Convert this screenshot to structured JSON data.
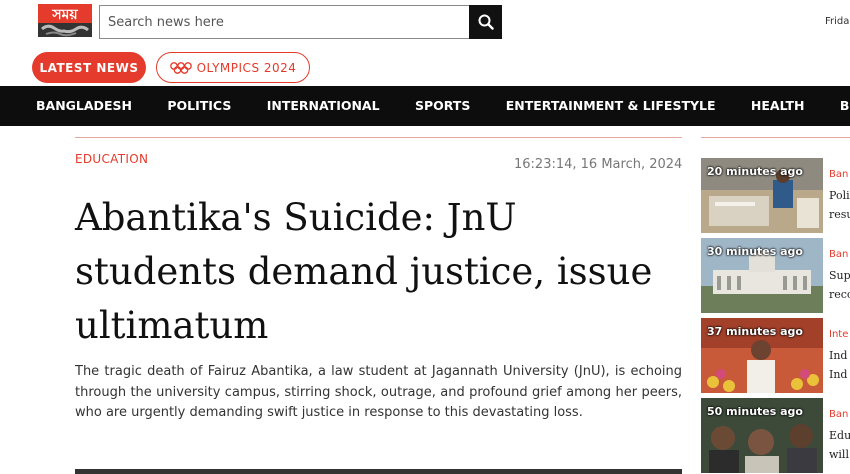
{
  "header": {
    "logo_text": "সময়",
    "search_placeholder": "Search news here",
    "date_partial": "Frida"
  },
  "pills": {
    "latest": "LATEST NEWS",
    "olympics": "OLYMPICS 2024"
  },
  "nav": [
    "BANGLADESH",
    "POLITICS",
    "INTERNATIONAL",
    "SPORTS",
    "ENTERTAINMENT & LIFESTYLE",
    "HEALTH",
    "BUSINESS"
  ],
  "article": {
    "category": "EDUCATION",
    "timestamp": "16:23:14, 16 March, 2024",
    "headline": "Abantika's Suicide: JnU students demand justice, issue ultimatum",
    "summary": "The tragic death of Fairuz Abantika, a law student at Jagannath University (JnU), is echoing through the university campus, stirring shock, outrage, and profound grief among her peers, who are urgently demanding swift justice in response to this devastating loss."
  },
  "sidebar": [
    {
      "time": "20 minutes ago",
      "category": "Ban",
      "title": "Poli\nresu"
    },
    {
      "time": "30 minutes ago",
      "category": "Ban",
      "title": "Sup\nreco"
    },
    {
      "time": "37 minutes ago",
      "category": "Inte",
      "title": "Ind\nInd"
    },
    {
      "time": "50 minutes ago",
      "category": "Ban",
      "title": "Edu\nwill"
    }
  ],
  "colors": {
    "accent": "#e43b2c",
    "nav_bg": "#0d0d0d"
  }
}
